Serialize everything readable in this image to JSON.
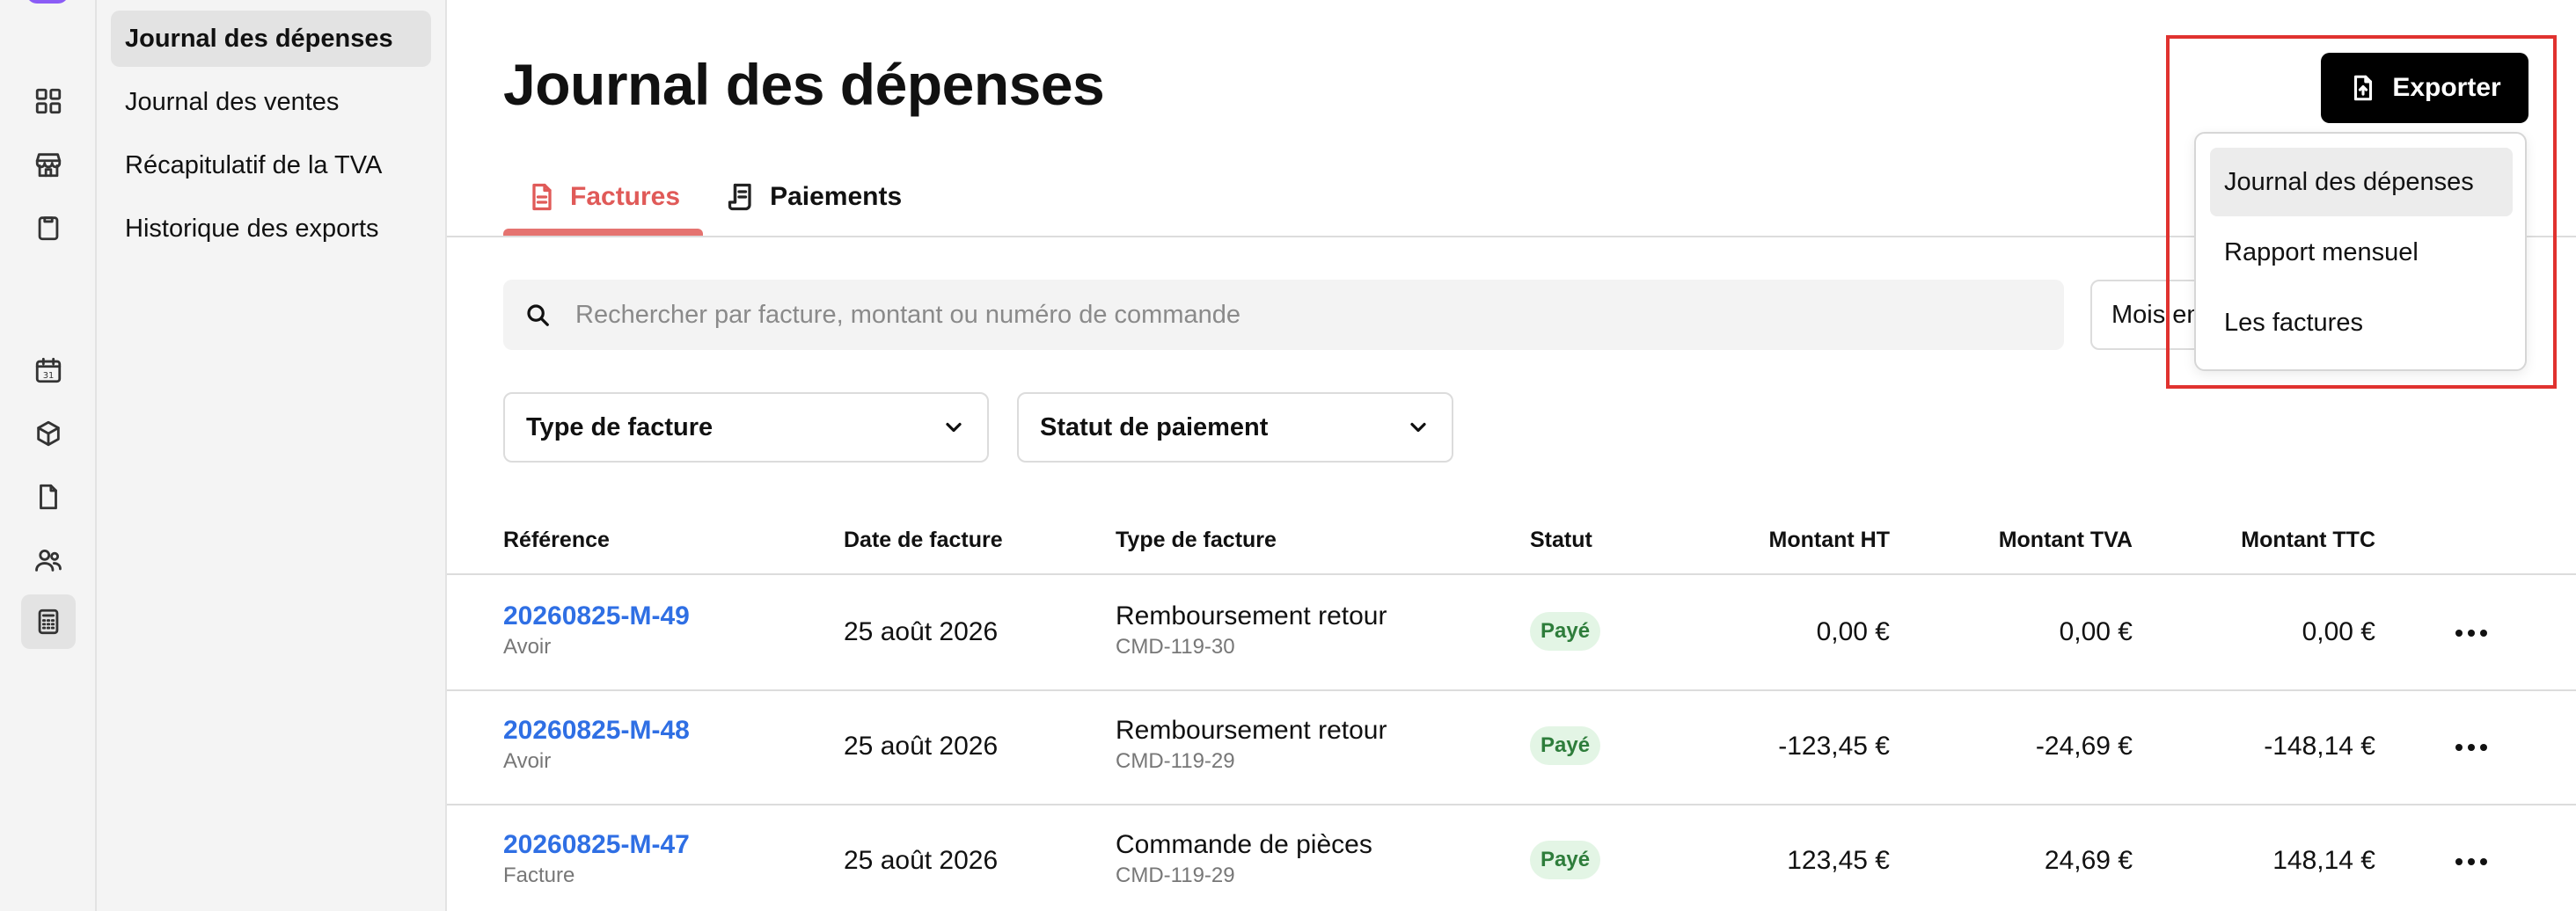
{
  "sidebar_nav": {
    "items": [
      {
        "label": "Journal des dépenses",
        "active": true
      },
      {
        "label": "Journal des ventes",
        "active": false
      },
      {
        "label": "Récapitulatif de la TVA",
        "active": false
      },
      {
        "label": "Historique des exports",
        "active": false
      }
    ]
  },
  "rail": {
    "icons": [
      "dashboard-icon",
      "store-icon",
      "clipboard-icon",
      "calendar-icon",
      "box-icon",
      "document-icon",
      "users-icon",
      "calculator-icon"
    ],
    "calendar_day": "31",
    "active_icon": "calculator-icon"
  },
  "header": {
    "title": "Journal des dépenses",
    "export_label": "Exporter"
  },
  "tabs": [
    {
      "label": "Factures",
      "active": true,
      "icon": "document-icon"
    },
    {
      "label": "Paiements",
      "active": false,
      "icon": "receipt-icon"
    }
  ],
  "search": {
    "placeholder": "Rechercher par facture, montant ou numéro de commande",
    "value": ""
  },
  "month_filter": {
    "visible_text": "Mois en"
  },
  "filters": {
    "invoice_type": "Type de facture",
    "payment_status": "Statut de paiement"
  },
  "export_menu": {
    "items": [
      {
        "label": "Journal des dépenses",
        "highlighted": true
      },
      {
        "label": "Rapport mensuel",
        "highlighted": false
      },
      {
        "label": "Les factures",
        "highlighted": false
      }
    ]
  },
  "table": {
    "columns": [
      "Référence",
      "Date de facture",
      "Type de facture",
      "Statut",
      "Montant HT",
      "Montant TVA",
      "Montant TTC"
    ],
    "rows": [
      {
        "reference": "20260825-M-49",
        "kind": "Avoir",
        "date": "25 août 2026",
        "type": "Remboursement retour",
        "order": "CMD-119-30",
        "status": "Payé",
        "ht": "0,00 €",
        "tva": "0,00 €",
        "ttc": "0,00 €"
      },
      {
        "reference": "20260825-M-48",
        "kind": "Avoir",
        "date": "25 août 2026",
        "type": "Remboursement retour",
        "order": "CMD-119-29",
        "status": "Payé",
        "ht": "-123,45 €",
        "tva": "-24,69 €",
        "ttc": "-148,14 €"
      },
      {
        "reference": "20260825-M-47",
        "kind": "Facture",
        "date": "25 août 2026",
        "type": "Commande de pièces",
        "order": "CMD-119-29",
        "status": "Payé",
        "ht": "123,45 €",
        "tva": "24,69 €",
        "ttc": "148,14 €"
      }
    ]
  },
  "colors": {
    "accent_tab": "#e05a58",
    "link": "#2f6fe4",
    "status_paid_bg": "#e3f5e5",
    "status_paid_text": "#2e7d3b",
    "highlight_outline": "#e0322f"
  }
}
